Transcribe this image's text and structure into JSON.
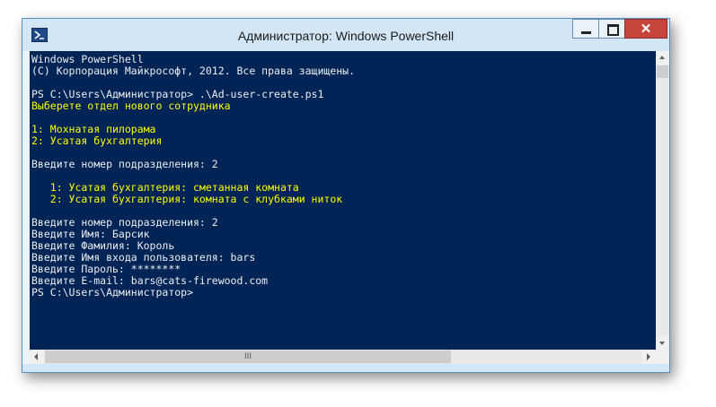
{
  "window": {
    "title": "Администратор: Windows PowerShell",
    "close_label": "✕"
  },
  "console": {
    "lines": [
      {
        "text": "Windows PowerShell",
        "color": "white"
      },
      {
        "text": "(C) Корпорация Майкрософт, 2012. Все права защищены.",
        "color": "white"
      },
      {
        "text": "",
        "color": "white"
      },
      {
        "text": "PS C:\\Users\\Администратор> .\\Ad-user-create.ps1",
        "color": "white"
      },
      {
        "text": "Выберете отдел нового сотрудника",
        "color": "yellow"
      },
      {
        "text": "",
        "color": "white"
      },
      {
        "text": "1: Мохнатая пилорама",
        "color": "yellow"
      },
      {
        "text": "2: Усатая бухгалтерия",
        "color": "yellow"
      },
      {
        "text": "",
        "color": "white"
      },
      {
        "text": "Введите номер подразделения: 2",
        "color": "white"
      },
      {
        "text": "",
        "color": "white"
      },
      {
        "text": "   1: Усатая бухгалтерия: сметанная комната",
        "color": "yellow"
      },
      {
        "text": "   2: Усатая бухгалтерия: комната с клубками ниток",
        "color": "yellow"
      },
      {
        "text": "",
        "color": "white"
      },
      {
        "text": "Введите номер подразделения: 2",
        "color": "white"
      },
      {
        "text": "Введите Имя: Барсик",
        "color": "white"
      },
      {
        "text": "Введите Фамилия: Король",
        "color": "white"
      },
      {
        "text": "Введите Имя входа пользователя: bars",
        "color": "white"
      },
      {
        "text": "Введите Пароль: ********",
        "color": "white"
      },
      {
        "text": "Введите E-mail: bars@cats-firewood.com",
        "color": "white"
      },
      {
        "text": "PS C:\\Users\\Администратор>",
        "color": "white"
      }
    ]
  },
  "colors": {
    "console_background": "#012456",
    "text_white": "#eeedf0",
    "text_yellow": "#ffff00",
    "close_button": "#c7443b"
  },
  "icons": {
    "app": "powershell-icon",
    "minimize": "minimize-icon",
    "maximize": "maximize-icon",
    "close": "close-icon"
  },
  "scrollbar": {
    "h_thumb_grip": "III"
  }
}
